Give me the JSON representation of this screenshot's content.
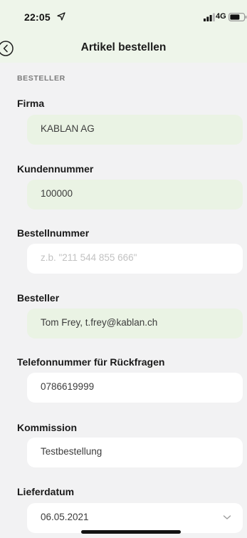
{
  "status_bar": {
    "time": "22:05",
    "network": "4G",
    "icons": [
      "location-arrow-icon",
      "signal-icon",
      "battery-icon"
    ]
  },
  "nav": {
    "title": "Artikel bestellen",
    "back_icon": "chevron-left-circle-icon"
  },
  "section": {
    "label": "BESTELLER"
  },
  "fields": {
    "firma": {
      "label": "Firma",
      "value": "KABLAN AG"
    },
    "kundennummer": {
      "label": "Kundennummer",
      "value": "100000"
    },
    "bestellnummer": {
      "label": "Bestellnummer",
      "placeholder": "z.b. \"211 544 855 666\""
    },
    "besteller": {
      "label": "Besteller",
      "value": "Tom Frey, t.frey@kablan.ch"
    },
    "telefon": {
      "label": "Telefonnummer für Rückfragen",
      "value": "0786619999"
    },
    "kommission": {
      "label": "Kommission",
      "value": "Testbestellung"
    },
    "lieferdatum": {
      "label": "Lieferdatum",
      "value": "06.05.2021"
    }
  },
  "colors": {
    "header_bg": "#eef5ea",
    "page_bg": "#f2f2f3",
    "prefilled_field_bg": "#eaf3e4",
    "field_bg": "#ffffff"
  }
}
